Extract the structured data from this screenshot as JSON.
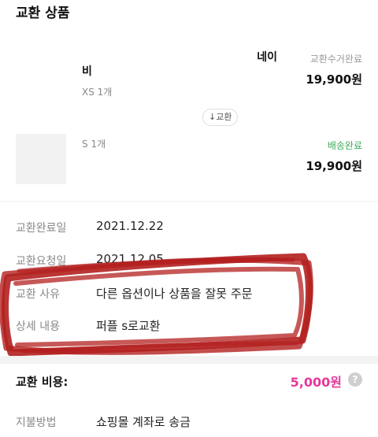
{
  "section": {
    "title": "교환 상품"
  },
  "items": [
    {
      "name_top": "네이",
      "name": "비",
      "option": "XS",
      "qty": "1개",
      "status": "교환수거완료",
      "price": "19,900원"
    },
    {
      "option": "S",
      "qty": "1개",
      "status": "배송완료",
      "price": "19,900원"
    }
  ],
  "swap": {
    "label": "↓교환"
  },
  "details": {
    "completed_date": {
      "label": "교환완료일",
      "value": "2021.12.22"
    },
    "request_date": {
      "label": "교환요청일",
      "value": "2021.12.05"
    },
    "reason": {
      "label": "교환 사유",
      "value": "다른 옵션이나 상품을 잘못 주문"
    },
    "description": {
      "label": "상세 내용",
      "value": "퍼플 s로교환"
    }
  },
  "fee": {
    "label": "교환 비용:",
    "value": "5,000원",
    "help_icon": "?"
  },
  "payment": {
    "label": "지불방법",
    "value": "쇼핑몰 계좌로 송금"
  },
  "colors": {
    "accent_pink": "#e5399b",
    "status_green": "#3dab5a",
    "annotation_red": "#b3201f"
  }
}
